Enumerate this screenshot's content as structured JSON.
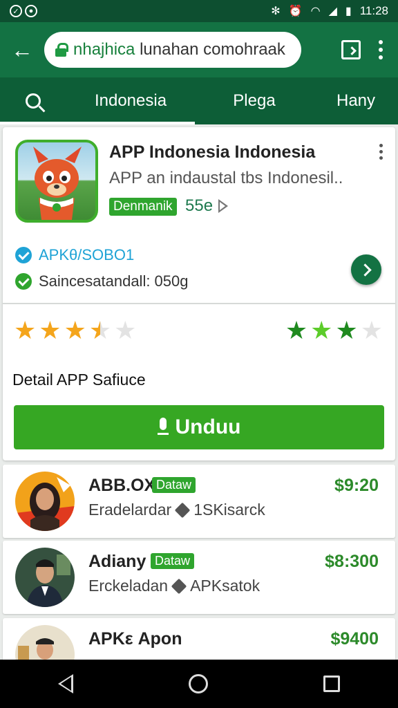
{
  "status_bar": {
    "time": "11:28",
    "left_icons": [
      "notification-icon",
      "notification-icon"
    ],
    "right_icons": [
      "bluetooth-icon",
      "alarm-icon",
      "wifi-icon",
      "signal-icon",
      "battery-icon"
    ]
  },
  "browser": {
    "url_highlight": "nhajhica",
    "url_rest": " lunahan comohraak"
  },
  "tabs": [
    "Indonesia",
    "Plega",
    "Hany"
  ],
  "app": {
    "title": "APP Indonesia Indonesia",
    "description": "APP an indaustal tbs Indonesil..",
    "badge": "Denmanik",
    "size": "55e",
    "meta_version": "APKθ/SOBO1",
    "meta_size": "Saincesatandall: 050g",
    "detail_label": "Detail APP Safiuce",
    "download_label": "Unduu",
    "rating_left": 3.5,
    "rating_right": 3,
    "colors": {
      "accent": "#137243",
      "button": "#36a723",
      "badge": "#2fa52e"
    }
  },
  "list": [
    {
      "title": "ABB.OX",
      "badge": "Dataw",
      "sub_left": "Eradelardar",
      "sub_right": "1SKisarck",
      "price": "$9:20"
    },
    {
      "title": "Adiany",
      "badge": "Dataw",
      "sub_left": "Erckeladan",
      "sub_right": "APKsatok",
      "price": "$8:300"
    },
    {
      "title": "APKε Apon",
      "badge": "",
      "sub_left": "",
      "sub_right": "",
      "price": "$9400"
    }
  ]
}
